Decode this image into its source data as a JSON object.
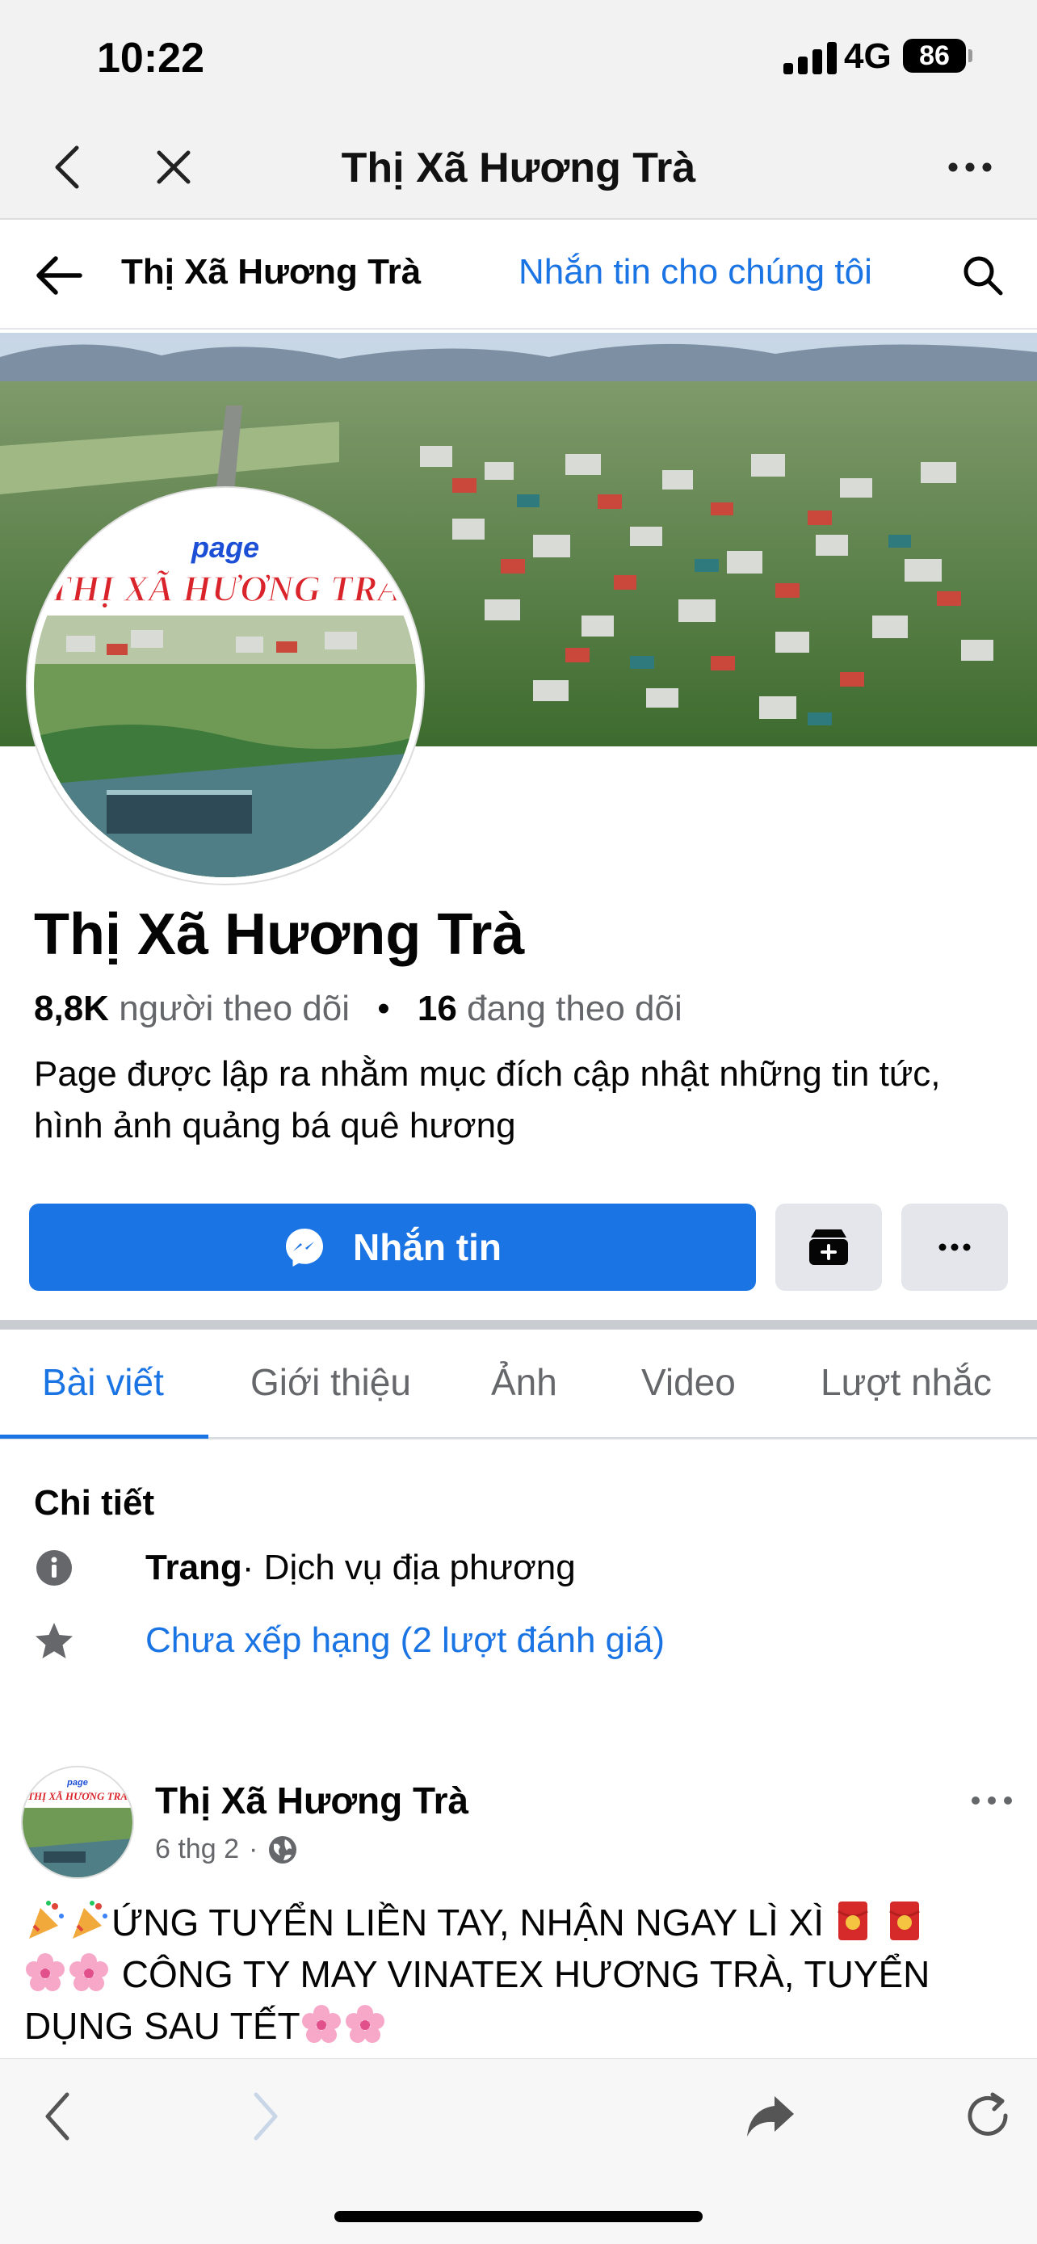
{
  "status_bar": {
    "time": "10:22",
    "network": "4G",
    "battery": "86"
  },
  "browser": {
    "title": "Thị Xã Hương Trà"
  },
  "header": {
    "page_name": "Thị Xã Hương Trà",
    "message_link": "Nhắn tin cho chúng tôi"
  },
  "cover": {
    "avatar_text_top": "page",
    "avatar_text_main": "THỊ XÃ HƯƠNG TRÀ"
  },
  "profile": {
    "name": "Thị Xã Hương Trà",
    "followers_count": "8,8K",
    "followers_label": "người theo dõi",
    "separator": "•",
    "following_count": "16",
    "following_label": "đang theo dõi",
    "bio": "Page được lập ra nhằm mục đích cập nhật những tin tức, hình ảnh quảng bá quê hương"
  },
  "actions": {
    "message_button": "Nhắn tin"
  },
  "tabs": [
    {
      "label": "Bài viết",
      "active": true
    },
    {
      "label": "Giới thiệu",
      "active": false
    },
    {
      "label": "Ảnh",
      "active": false
    },
    {
      "label": "Video",
      "active": false
    },
    {
      "label": "Lượt nhắc",
      "active": false
    }
  ],
  "details": {
    "title": "Chi tiết",
    "category_bold": "Trang",
    "category_rest": " · Dịch vụ địa phương",
    "rating": "Chưa xếp hạng (2 lượt đánh giá)"
  },
  "post": {
    "author": "Thị Xã Hương Trà",
    "date": "6 thg 2",
    "dot": "·",
    "line1": "ỨNG TUYỂN LIỀN TAY, NHẬN NGAY LÌ XÌ",
    "line2": " CÔNG TY MAY VINATEX HƯƠNG TRÀ, TUYỂN DỤNG SAU TẾT"
  },
  "colors": {
    "accent": "#1b74e4",
    "secondary_text": "#65676b",
    "button_gray": "#e4e6eb"
  }
}
